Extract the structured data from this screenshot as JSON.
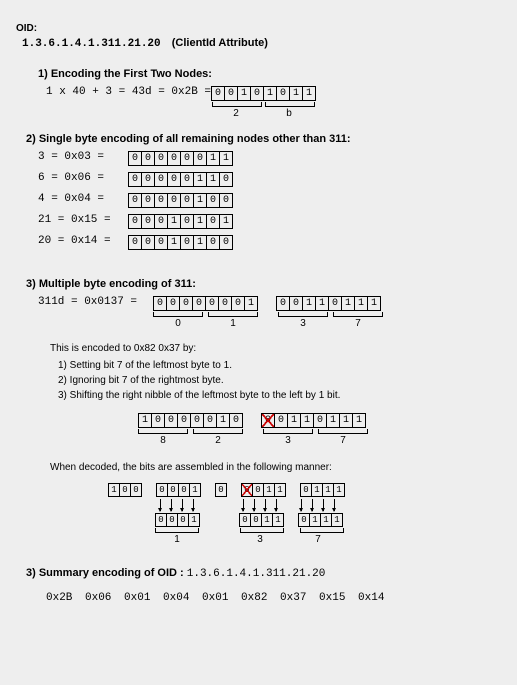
{
  "header": {
    "title": "OID:",
    "value": "1.3.6.1.4.1.311.21.20",
    "note": "(ClientId Attribute)"
  },
  "s1": {
    "title": "1) Encoding the First Two Nodes:",
    "expr": "1 x 40 + 3 = 43d = 0x2B =",
    "bits": [
      "0",
      "0",
      "1",
      "0",
      "1",
      "0",
      "1",
      "1"
    ],
    "nibble_l": "2",
    "nibble_r": "b"
  },
  "s2": {
    "title": "2) Single byte encoding of all remaining nodes other than 311:",
    "rows": [
      {
        "l": "3  = 0x03 =",
        "b": [
          "0",
          "0",
          "0",
          "0",
          "0",
          "0",
          "1",
          "1"
        ]
      },
      {
        "l": "6  = 0x06 =",
        "b": [
          "0",
          "0",
          "0",
          "0",
          "0",
          "1",
          "1",
          "0"
        ]
      },
      {
        "l": "4  = 0x04 =",
        "b": [
          "0",
          "0",
          "0",
          "0",
          "0",
          "1",
          "0",
          "0"
        ]
      },
      {
        "l": "21 = 0x15 =",
        "b": [
          "0",
          "0",
          "0",
          "1",
          "0",
          "1",
          "0",
          "1"
        ]
      },
      {
        "l": "20 = 0x14 =",
        "b": [
          "0",
          "0",
          "0",
          "1",
          "0",
          "1",
          "0",
          "0"
        ]
      }
    ]
  },
  "s3": {
    "title": "3) Multiple byte encoding of 311:",
    "expr": "311d = 0x0137 =",
    "byte1": [
      "0",
      "0",
      "0",
      "0",
      "0",
      "0",
      "0",
      "1"
    ],
    "byte2": [
      "0",
      "0",
      "1",
      "1",
      "0",
      "1",
      "1",
      "1"
    ],
    "nibbles": [
      "0",
      "1",
      "3",
      "7"
    ],
    "explain": "This is encoded to 0x82 0x37 by:",
    "steps": [
      "1) Setting bit 7 of the leftmost byte to 1.",
      "2) Ignoring bit 7 of the rightmost byte.",
      "3) Shifting the right nibble of the leftmost byte to the left by 1 bit."
    ],
    "enc1": [
      "1",
      "0",
      "0",
      "0",
      "0",
      "0",
      "1",
      "0"
    ],
    "enc2": [
      "0",
      "0",
      "1",
      "1",
      "0",
      "1",
      "1",
      "1"
    ],
    "enc_nibbles": [
      "8",
      "2",
      "3",
      "7"
    ],
    "decode": "When decoded, the bits are assembled in the following manner:",
    "dec_top": {
      "g1": [
        "1",
        "0",
        "0"
      ],
      "g2": [
        "0",
        "0",
        "0",
        "1"
      ],
      "g3": [
        "0"
      ],
      "g4": [
        "0",
        "0",
        "1",
        "1"
      ],
      "g5": [
        "0",
        "1",
        "1",
        "1"
      ]
    },
    "dec_bot": {
      "g1": [
        "0",
        "0",
        "0",
        "1"
      ],
      "g2": [
        "0",
        "0",
        "1",
        "1"
      ],
      "g3": [
        "0",
        "1",
        "1",
        "1"
      ]
    },
    "dec_nibbles": [
      "1",
      "3",
      "7"
    ]
  },
  "s4": {
    "title": "3) Summary encoding of OID :",
    "oid": "1.3.6.1.4.1.311.21.20",
    "bytes": "0x2B  0x06  0x01  0x04  0x01  0x82  0x37  0x15  0x14"
  }
}
